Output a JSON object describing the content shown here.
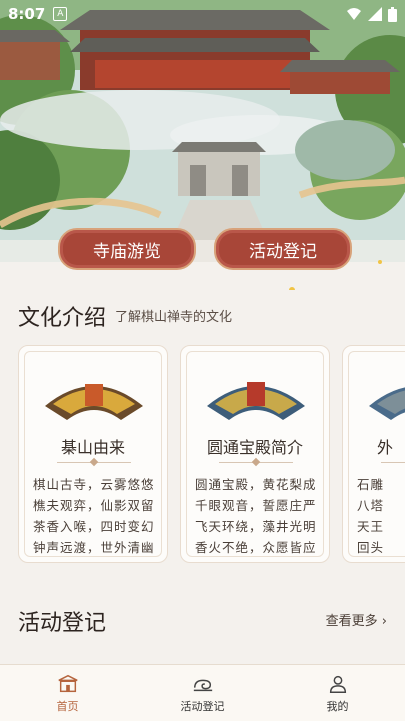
{
  "status": {
    "time": "8:07"
  },
  "hero": {
    "buttons": [
      "寺庙游览",
      "活动登记"
    ]
  },
  "culture": {
    "title": "文化介绍",
    "subtitle": "了解棋山禅寺的文化",
    "cards": [
      {
        "title": "棊山由来",
        "lines": [
          "棋山古寺，云雾悠悠",
          "樵夫观弈，仙影双留",
          "茶香入喉，四时变幻",
          "钟声远渡，世外清幽"
        ]
      },
      {
        "title": "圆通宝殿简介",
        "lines": [
          "圆通宝殿，黄花梨成",
          "千眼观音，誓愿庄严",
          "飞天环绕，藻井光明",
          "香火不绝，众愿皆应"
        ]
      },
      {
        "title": "外",
        "lines": [
          "石雕",
          "八塔",
          "天王",
          "回头"
        ]
      }
    ]
  },
  "activity": {
    "title": "活动登记",
    "more": "查看更多"
  },
  "tabs": [
    {
      "label": "首页",
      "icon": "temple-icon",
      "active": true
    },
    {
      "label": "活动登记",
      "icon": "cloud-scroll-icon",
      "active": false
    },
    {
      "label": "我的",
      "icon": "person-icon",
      "active": false
    }
  ]
}
